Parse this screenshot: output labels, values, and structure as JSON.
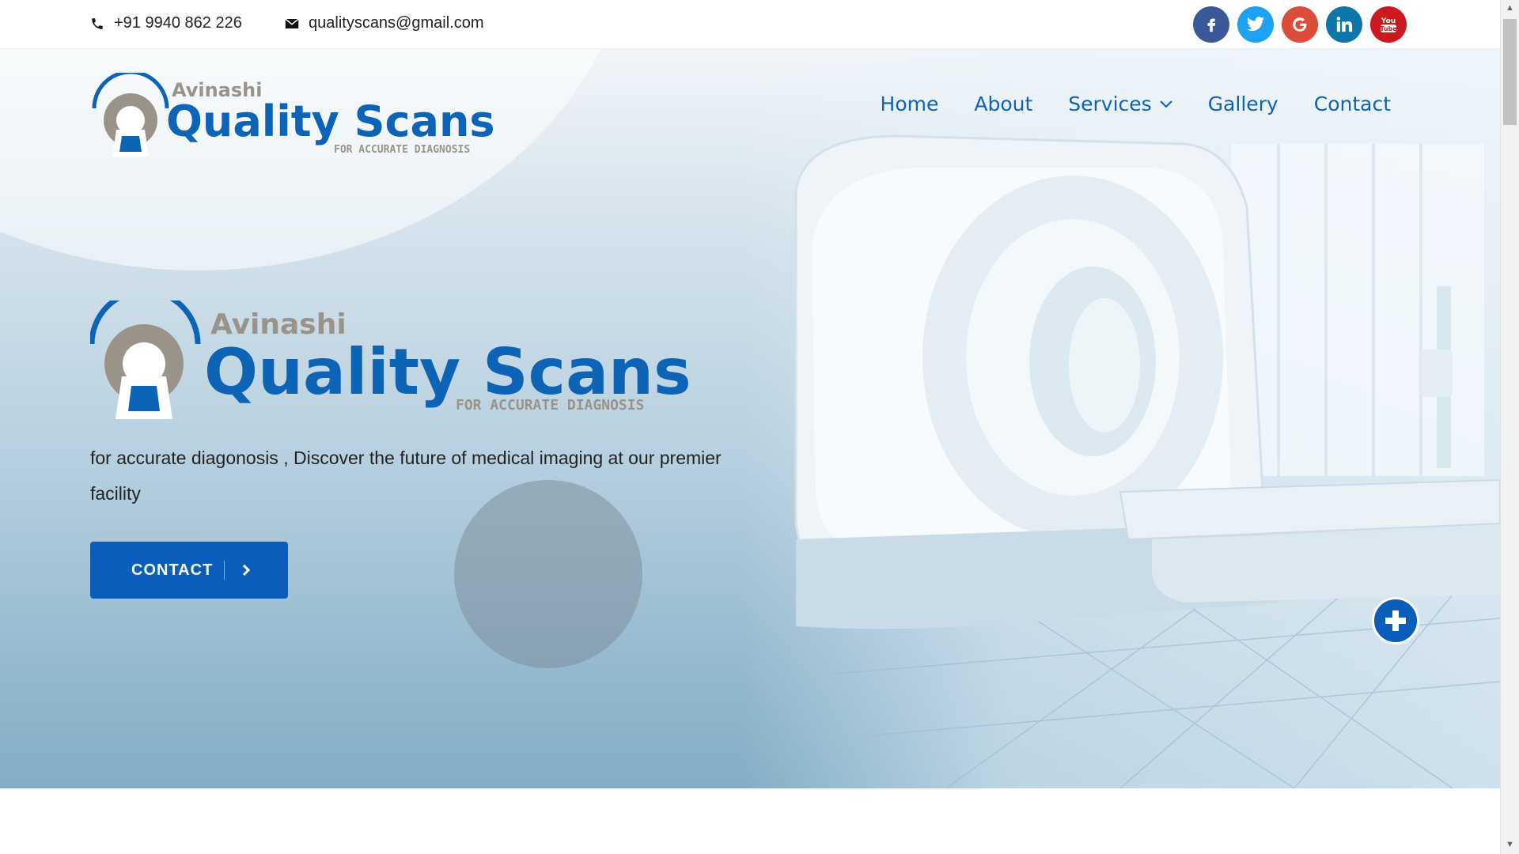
{
  "topbar": {
    "phone": "+91 9940 862 226",
    "email": "qualityscans@gmail.com",
    "social": [
      {
        "name": "facebook",
        "glyph": "f",
        "color": "#3b5998"
      },
      {
        "name": "twitter",
        "glyph": "🐦",
        "color": "#1da1f2"
      },
      {
        "name": "google",
        "glyph": "G",
        "color": "#dd4b39"
      },
      {
        "name": "linkedin",
        "glyph": "in",
        "color": "#0e76a8"
      },
      {
        "name": "youtube",
        "glyph": "You Tube",
        "color": "#cc181e"
      }
    ]
  },
  "logo": {
    "prefix": "Avinashi",
    "name": "Quality Scans",
    "tag": "FOR ACCURATE DIAGNOSIS"
  },
  "nav": {
    "items": [
      "Home",
      "About",
      "Services",
      "Gallery",
      "Contact"
    ]
  },
  "hero": {
    "tagline": "for accurate diagonosis , Discover the future of medical imaging at our premier facility",
    "cta_label": "CONTACT"
  },
  "colors": {
    "primary": "#0a5db8",
    "logo_gray": "#9a938a"
  }
}
